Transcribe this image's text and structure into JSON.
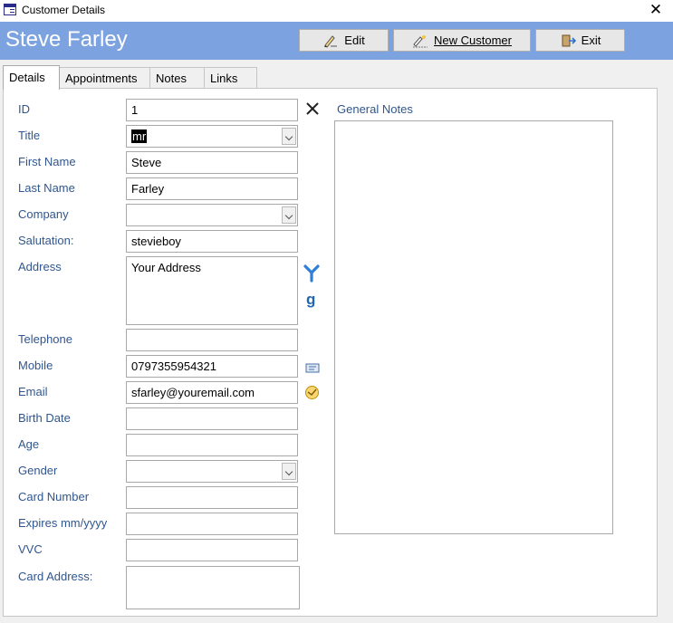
{
  "window": {
    "title": "Customer Details",
    "close_glyph": "✕"
  },
  "header": {
    "name": "Steve Farley",
    "buttons": [
      {
        "label": "Edit",
        "icon": "edit-icon"
      },
      {
        "label": "New Customer",
        "icon": "new-customer-icon"
      },
      {
        "label": "Exit",
        "icon": "exit-icon"
      }
    ]
  },
  "tabs": [
    "Details",
    "Appointments",
    "Notes",
    "Links"
  ],
  "form": {
    "id": {
      "label": "ID",
      "value": "1"
    },
    "title": {
      "label": "Title",
      "value": "mr"
    },
    "first_name": {
      "label": "First Name",
      "value": "Steve"
    },
    "last_name": {
      "label": "Last Name",
      "value": "Farley"
    },
    "company": {
      "label": "Company",
      "value": ""
    },
    "salutation": {
      "label": "Salutation:",
      "value": "stevieboy"
    },
    "address": {
      "label": "Address",
      "value": "Your Address"
    },
    "telephone": {
      "label": "Telephone",
      "value": ""
    },
    "mobile": {
      "label": "Mobile",
      "value": "0797355954321"
    },
    "email": {
      "label": "Email",
      "value": "sfarley@youremail.com"
    },
    "birth_date": {
      "label": "Birth Date",
      "value": ""
    },
    "age": {
      "label": "Age",
      "value": ""
    },
    "gender": {
      "label": "Gender",
      "value": ""
    },
    "card_number": {
      "label": "Card Number",
      "value": ""
    },
    "expires": {
      "label": "Expires mm/yyyy",
      "value": ""
    },
    "vvc": {
      "label": "VVC",
      "value": ""
    },
    "card_address": {
      "label": "Card Address:",
      "value": ""
    }
  },
  "general_notes": {
    "label": "General Notes",
    "value": ""
  },
  "icons": {
    "clear": "clear-x-icon",
    "yelp": "yelp-icon",
    "google": "google-icon",
    "sms": "sms-icon",
    "outlook": "outlook-icon"
  },
  "colors": {
    "header_bg": "#7da2e0",
    "label_text": "#30568f"
  }
}
